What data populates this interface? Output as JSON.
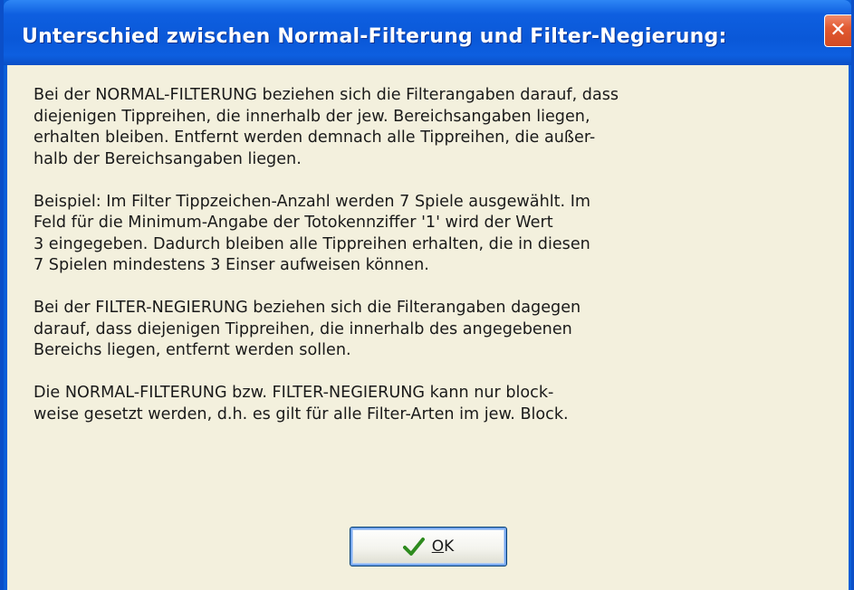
{
  "window": {
    "title": "Unterschied zwischen Normal-Filterung und Filter-Negierung:",
    "close_symbol": "✕",
    "close_icon": "close-icon"
  },
  "message": {
    "paragraphs": [
      "Bei der NORMAL-FILTERUNG beziehen sich die Filterangaben darauf, dass\ndiejenigen Tippreihen, die innerhalb der jew. Bereichsangaben liegen,\nerhalten bleiben. Entfernt werden demnach alle Tippreihen, die außer-\nhalb der Bereichsangaben liegen.",
      "Beispiel: Im Filter Tippzeichen-Anzahl werden 7 Spiele ausgewählt. Im\nFeld für die Minimum-Angabe der Totokennziffer '1' wird der Wert\n3 eingegeben. Dadurch bleiben alle Tippreihen erhalten, die in diesen\n7 Spielen mindestens 3 Einser aufweisen können.",
      "Bei der FILTER-NEGIERUNG beziehen sich die Filterangaben dagegen\ndarauf, dass diejenigen Tippreihen, die innerhalb des angegebenen\nBereichs liegen, entfernt werden sollen.",
      "Die NORMAL-FILTERUNG bzw. FILTER-NEGIERUNG kann nur block-\nweise gesetzt werden, d.h. es gilt für alle Filter-Arten im jew. Block."
    ]
  },
  "buttons": {
    "ok_label": "OK",
    "ok_icon": "checkmark-icon"
  },
  "colors": {
    "titlebar": "#0a58d8",
    "client_bg": "#f3f0dd",
    "close_btn": "#e25a32",
    "check_green": "#2e8b1e"
  }
}
